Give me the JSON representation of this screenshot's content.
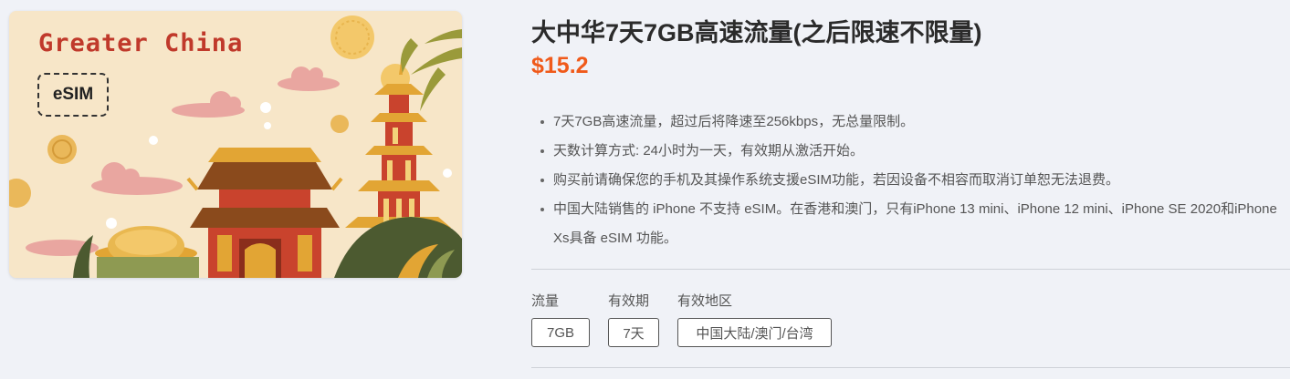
{
  "product_image": {
    "title_text": "Greater China",
    "badge_text": "eSIM"
  },
  "product": {
    "title": "大中华7天7GB高速流量(之后限速不限量)",
    "price": "$15.2"
  },
  "features": [
    "7天7GB高速流量，超过后将降速至256kbps，无总量限制。",
    "天数计算方式: 24小时为一天，有效期从激活开始。",
    "购买前请确保您的手机及其操作系统支援eSIM功能，若因设备不相容而取消订单恕无法退费。",
    "中国大陆销售的 iPhone 不支持 eSIM。在香港和澳门，只有iPhone 13 mini、iPhone 12 mini、iPhone SE 2020和iPhone Xs具备 eSIM 功能。"
  ],
  "specs": {
    "data_label": "流量",
    "data_value": "7GB",
    "validity_label": "有效期",
    "validity_value": "7天",
    "region_label": "有效地区",
    "region_value": "中国大陆/澳门/台湾"
  },
  "colors": {
    "accent_price": "#f05a1a",
    "card_background": "#f7e6c8",
    "image_title": "#c0392b"
  }
}
